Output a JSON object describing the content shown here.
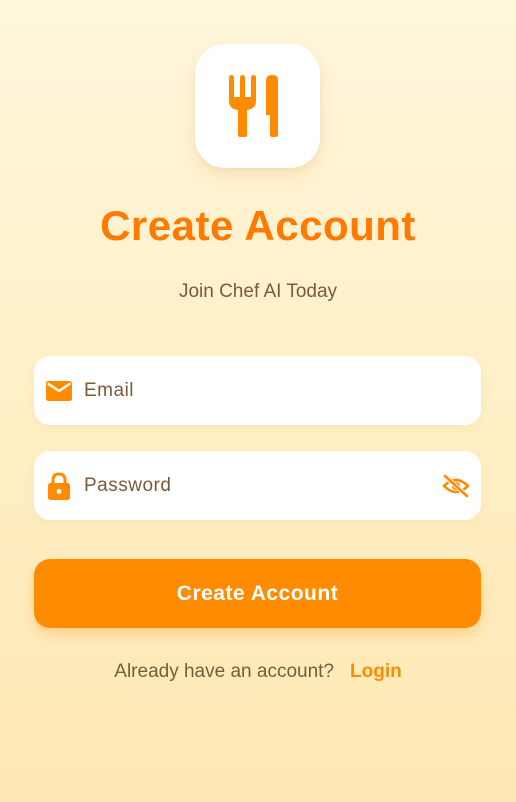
{
  "header": {
    "title": "Create Account",
    "subtitle": "Join Chef AI Today"
  },
  "form": {
    "email": {
      "placeholder": "Email",
      "value": "",
      "icon": "mail-icon"
    },
    "password": {
      "placeholder": "Password",
      "value": "",
      "icon": "lock-icon",
      "toggle_icon": "eye-off-icon"
    },
    "submit_label": "Create Account"
  },
  "footer": {
    "prompt": "Already have an account?",
    "link_label": "Login"
  },
  "colors": {
    "accent": "#ff7a00",
    "button": "#ff8c00",
    "text_muted": "#7a5a3a",
    "background": "#fff2cf"
  },
  "logo": {
    "icon": "restaurant-icon"
  }
}
